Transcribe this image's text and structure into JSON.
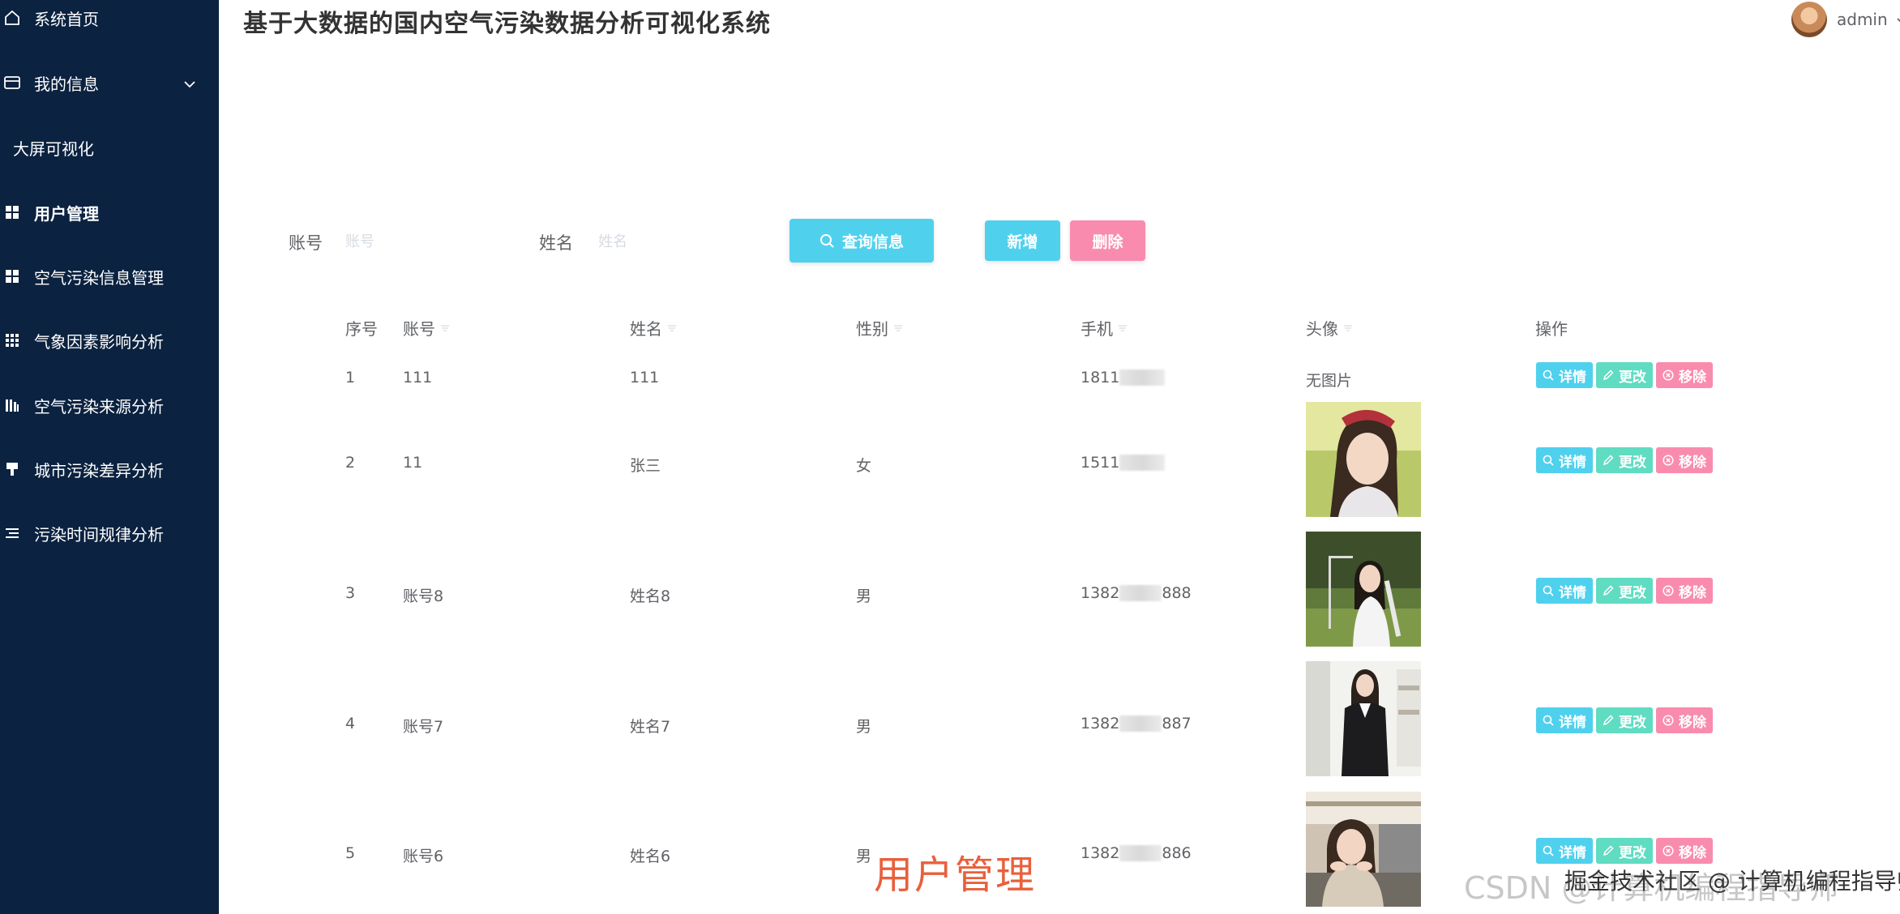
{
  "app": {
    "title": "基于大数据的国内空气污染数据分析可视化系统",
    "user": "admin"
  },
  "sidebar": {
    "items": [
      {
        "label": "系统首页",
        "icon": "home-icon"
      },
      {
        "label": "我的信息",
        "icon": "card-icon"
      },
      {
        "label": "大屏可视化"
      },
      {
        "label": "用户管理",
        "icon": "grid-icon",
        "active": true
      },
      {
        "label": "空气污染信息管理",
        "icon": "grid-icon"
      },
      {
        "label": "气象因素影响分析",
        "icon": "dots-grid-icon"
      },
      {
        "label": "空气污染来源分析",
        "icon": "bars-icon"
      },
      {
        "label": "城市污染差异分析",
        "icon": "brush-icon"
      },
      {
        "label": "污染时间规律分析",
        "icon": "list-icon"
      }
    ]
  },
  "search": {
    "account_label": "账号",
    "account_placeholder": "账号",
    "name_label": "姓名",
    "name_placeholder": "姓名",
    "search_button": "查询信息",
    "add_button": "新增",
    "delete_button": "删除"
  },
  "table": {
    "headers": {
      "index": "序号",
      "account": "账号",
      "name": "姓名",
      "gender": "性别",
      "phone": "手机",
      "avatar": "头像",
      "actions": "操作"
    },
    "rows": [
      {
        "index": "1",
        "account": "111",
        "name": "111",
        "gender": "",
        "phone_start": "1811",
        "phone_end": "",
        "avatar_text": "无图片"
      },
      {
        "index": "2",
        "account": "11",
        "name": "张三",
        "gender": "女",
        "phone_start": "1511",
        "phone_end": "",
        "avatar_text": ""
      },
      {
        "index": "3",
        "account": "账号8",
        "name": "姓名8",
        "gender": "男",
        "phone_start": "1382",
        "phone_end": "888",
        "avatar_text": ""
      },
      {
        "index": "4",
        "account": "账号7",
        "name": "姓名7",
        "gender": "男",
        "phone_start": "1382",
        "phone_end": "887",
        "avatar_text": ""
      },
      {
        "index": "5",
        "account": "账号6",
        "name": "姓名6",
        "gender": "男",
        "phone_start": "1382",
        "phone_end": "886",
        "avatar_text": ""
      }
    ],
    "actions": {
      "detail": "详情",
      "edit": "更改",
      "remove": "移除"
    }
  },
  "overlay": {
    "caption": "用户管理",
    "watermark_light": "CSDN @计算机编程指导师",
    "watermark_dark": "掘金技术社区 @ 计算机编程指导师"
  },
  "colors": {
    "sidebar_bg": "#0b2240",
    "accent_cyan": "#4fd1ee",
    "accent_green": "#5fdcc1",
    "accent_pink": "#f98cae",
    "caption": "#e8603c"
  }
}
